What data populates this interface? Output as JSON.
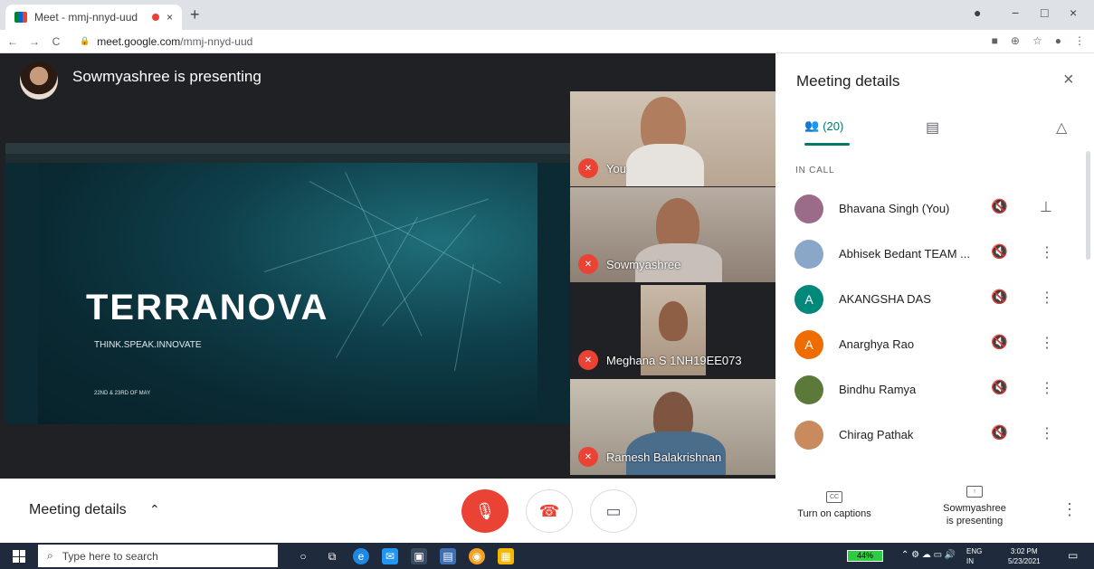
{
  "browser": {
    "tab_title": "Meet - mmj-nnyd-uud",
    "tab_close": "×",
    "new_tab": "+",
    "url_host": "meet.google.com",
    "url_path": "/mmj-nnyd-uud",
    "back": "←",
    "forward": "→",
    "reload": "C",
    "window_controls": {
      "minimize": "−",
      "maximize": "□",
      "close": "×"
    }
  },
  "presenting_banner": "Sowmyashree is presenting",
  "slide": {
    "title": "TERRANOVA",
    "tagline": "THINK.SPEAK.INNOVATE",
    "date": "22ND & 23RD OF MAY"
  },
  "tiles": [
    {
      "name": "You",
      "muted": true
    },
    {
      "name": "Sowmyashree",
      "muted": true
    },
    {
      "name": "Meghana S 1NH19EE073",
      "muted": true
    },
    {
      "name": "Ramesh Balakrishnan",
      "muted": true
    }
  ],
  "panel": {
    "title": "Meeting details",
    "close": "×",
    "people_count": "(20)",
    "section_label": "IN CALL",
    "participants": [
      {
        "name": "Bhavana Singh (You)",
        "avatar_letter": "",
        "avatar_color": "#9c6b8a",
        "action_icon": "pin-icon"
      },
      {
        "name": "Abhisek Bedant TEAM ...",
        "avatar_letter": "",
        "avatar_color": "#8aa6c8",
        "action_icon": "more-icon"
      },
      {
        "name": "AKANGSHA DAS",
        "avatar_letter": "A",
        "avatar_color": "#00897b",
        "action_icon": "more-icon"
      },
      {
        "name": "Anarghya Rao",
        "avatar_letter": "A",
        "avatar_color": "#ef6c00",
        "action_icon": "more-icon"
      },
      {
        "name": "Bindhu Ramya",
        "avatar_letter": "",
        "avatar_color": "#5b7a3a",
        "action_icon": "more-icon"
      },
      {
        "name": "Chirag Pathak",
        "avatar_letter": "",
        "avatar_color": "#c98a5e",
        "action_icon": "more-icon"
      }
    ]
  },
  "controls": {
    "meeting_details": "Meeting details",
    "captions_label": "Turn on captions",
    "captions_icon_text": "CC",
    "presenting_line1": "Sowmyashree",
    "presenting_line2": "is presenting"
  },
  "taskbar": {
    "search_placeholder": "Type here to search",
    "battery": "44%",
    "lang_top": "ENG",
    "lang_bottom": "IN",
    "time": "3:02 PM",
    "date": "5/23/2021"
  },
  "colors": {
    "mute_red": "#ea4335",
    "teal_accent": "#00796b",
    "stage_bg": "#202124"
  }
}
